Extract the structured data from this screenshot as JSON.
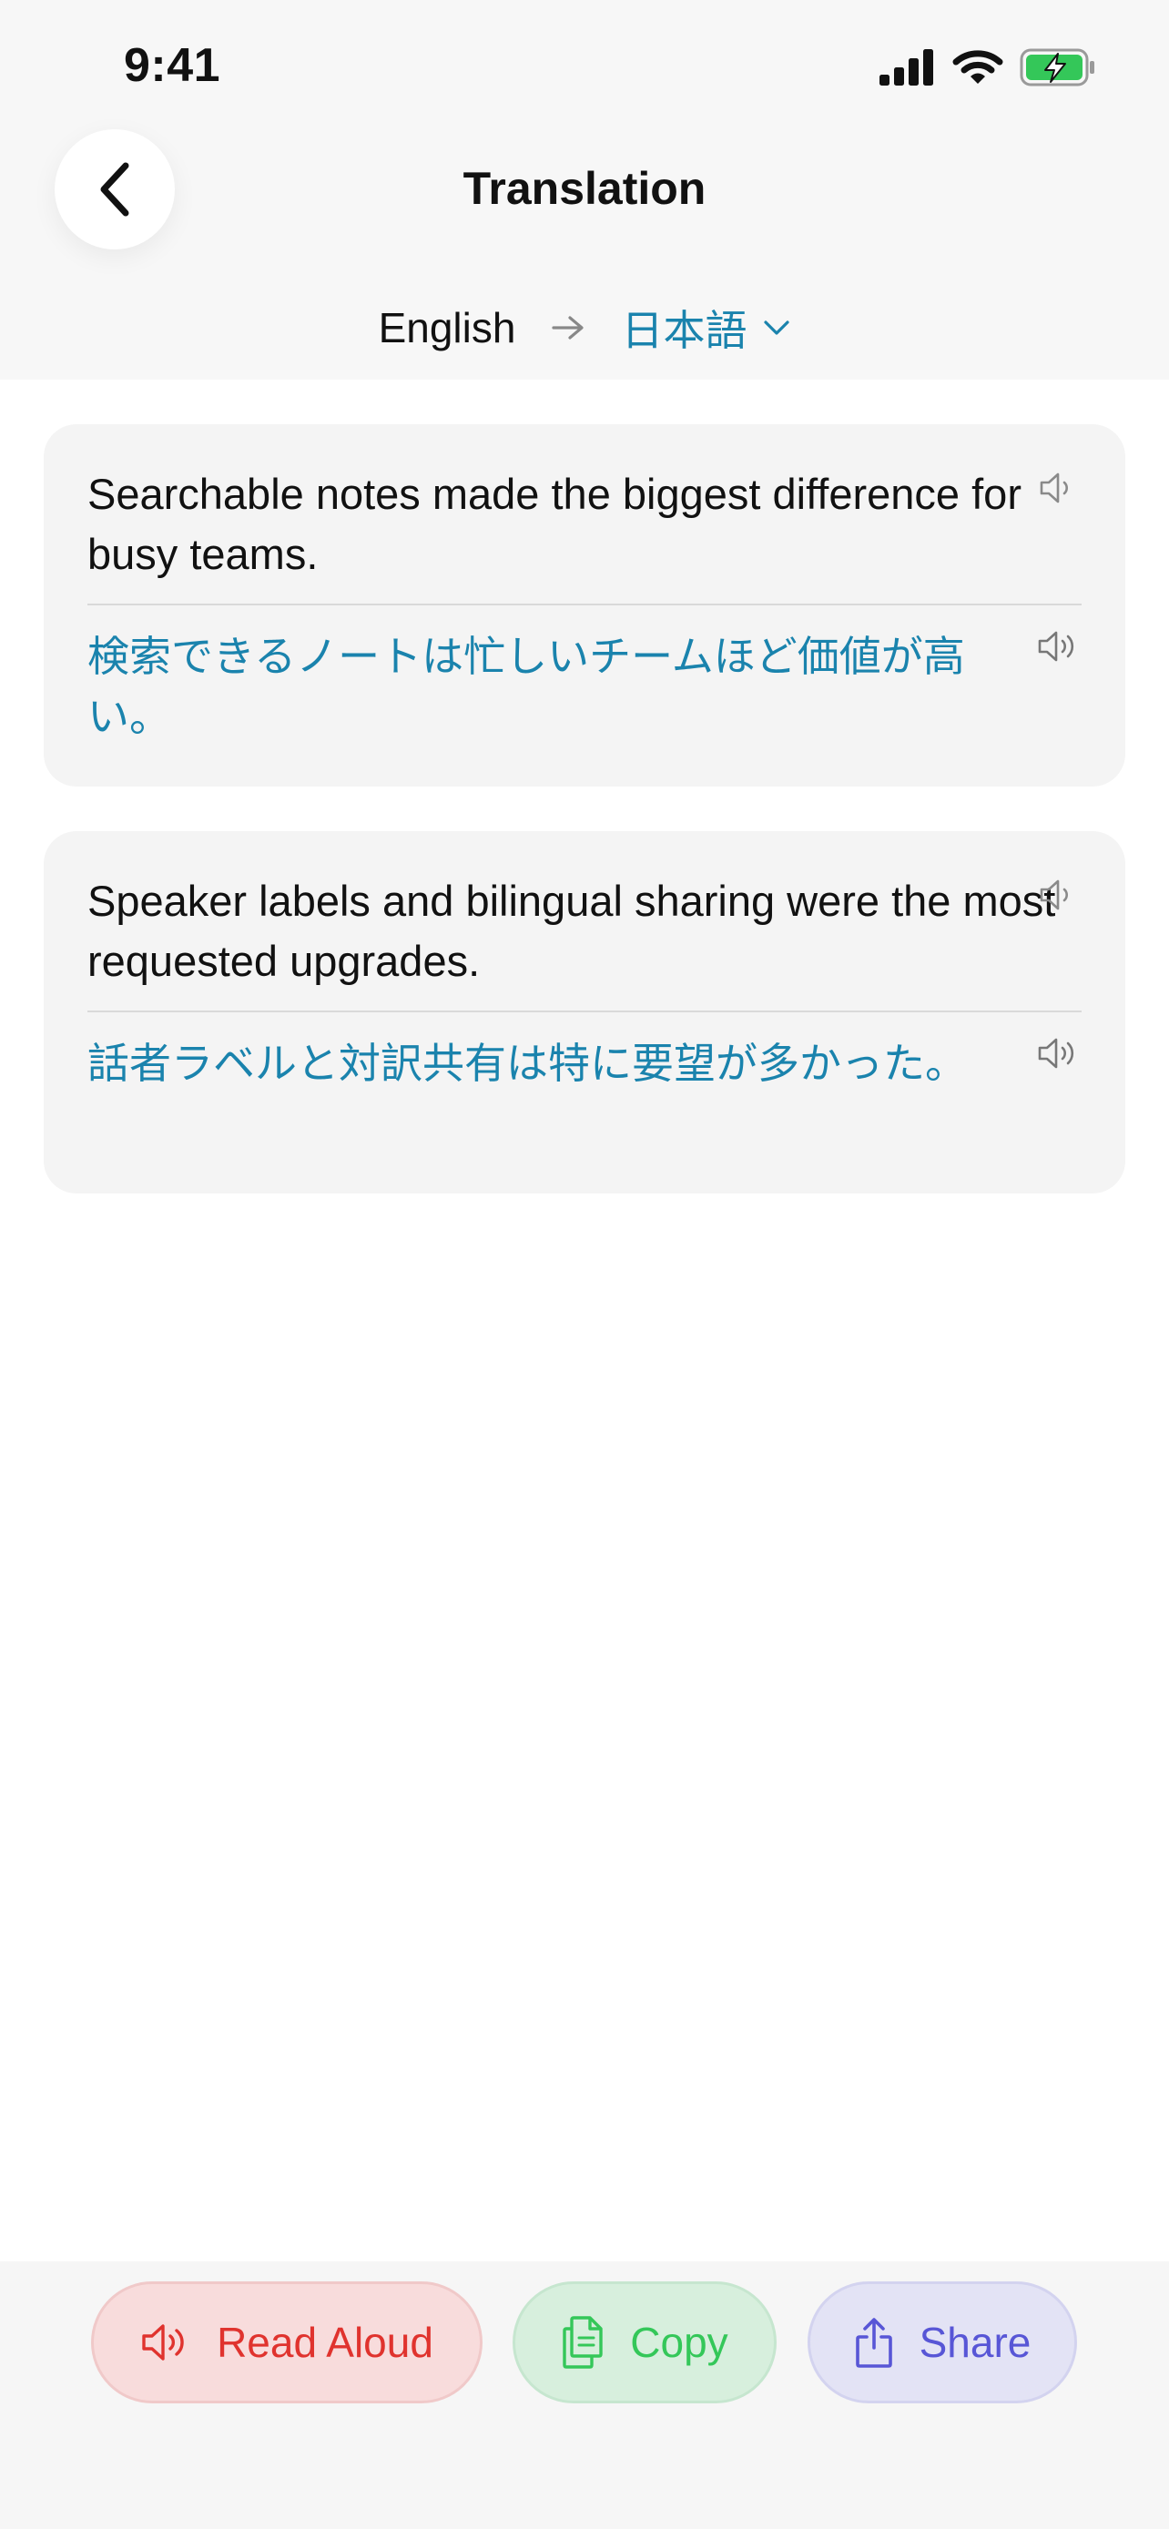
{
  "status_bar": {
    "time": "9:41"
  },
  "header": {
    "title": "Translation",
    "back_icon": "chevron-left-icon"
  },
  "language": {
    "source": "English",
    "target": "日本語"
  },
  "cards": [
    {
      "source_text": "Searchable notes made the biggest difference for busy teams.",
      "translated_text": "検索できるノートは忙しいチームほど価値が高い。"
    },
    {
      "source_text": "Speaker labels and bilingual sharing were the most requested upgrades.",
      "translated_text": "話者ラベルと対訳共有は特に要望が多かった。"
    }
  ],
  "actions": {
    "read_aloud": "Read Aloud",
    "copy": "Copy",
    "share": "Share"
  },
  "colors": {
    "accent_blue": "#1a83ad",
    "read_red": "#e0332e",
    "copy_green": "#34c759",
    "share_purple": "#5856d6",
    "battery_green": "#34c759"
  }
}
